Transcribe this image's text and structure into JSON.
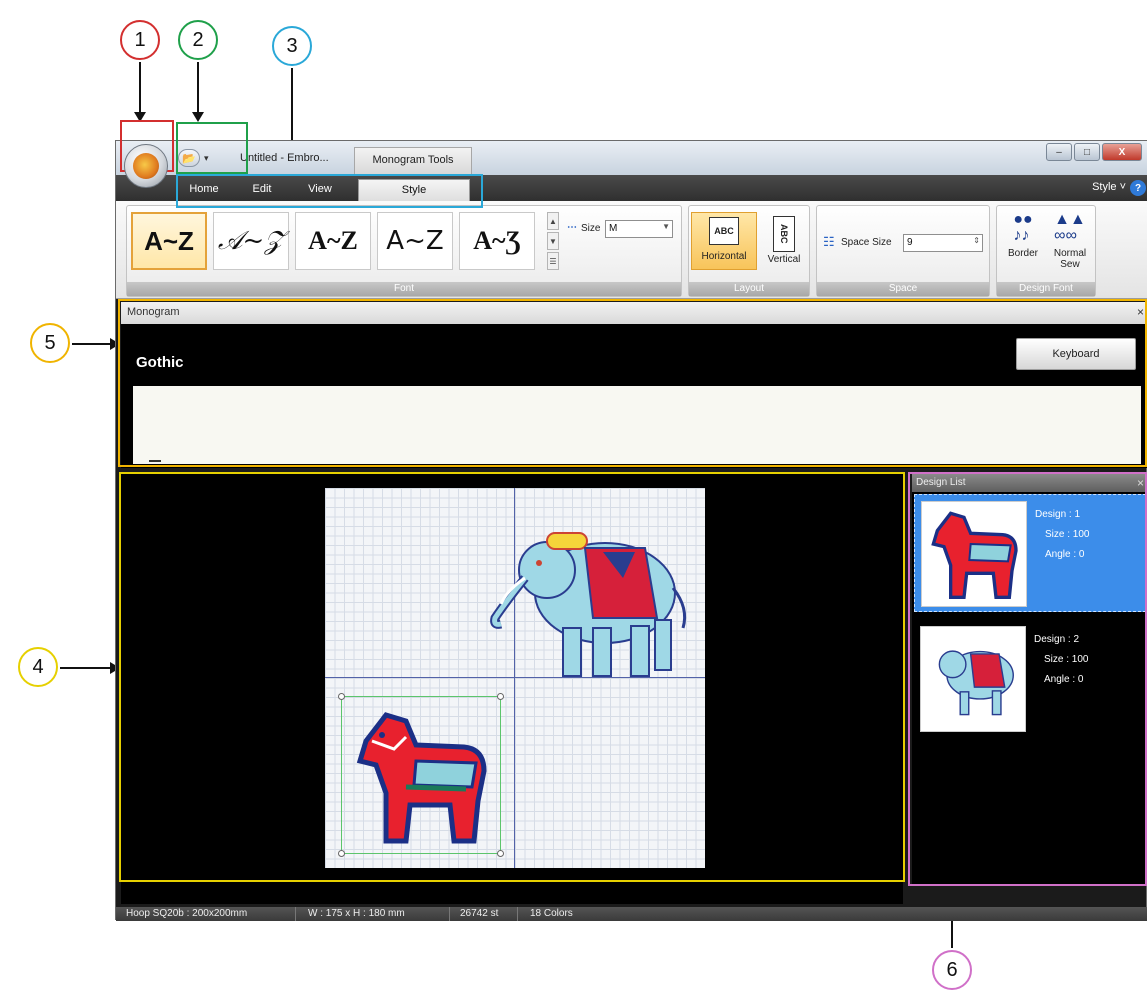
{
  "callouts": [
    "1",
    "2",
    "3",
    "4",
    "5",
    "6"
  ],
  "title_bar": {
    "document_title": "Untitled - Embro...",
    "context_tab": "Monogram Tools",
    "minimize": "–",
    "maximize": "□",
    "close": "X"
  },
  "tabs": {
    "home": "Home",
    "edit": "Edit",
    "view": "View",
    "style": "Style",
    "style_menu": "Style ˅",
    "help": "?"
  },
  "ribbon": {
    "font_group_label": "Font",
    "font_samples": [
      "A~Z",
      "𝒜~𝒵",
      "A~Z",
      "A~Z",
      "A~Ʒ"
    ],
    "size_label": "Size",
    "size_value": "M",
    "layout_group_label": "Layout",
    "horizontal_label": "Horizontal",
    "vertical_label": "Vertical",
    "abc": "ABC",
    "space_group_label": "Space",
    "space_size_label": "Space Size",
    "space_size_value": "9",
    "design_font_group_label": "Design Font",
    "border_label": "Border",
    "normal_sew_label": "Normal Sew"
  },
  "monogram": {
    "panel_title": "Monogram",
    "close": "×",
    "font_name": "Gothic",
    "keyboard_button": "Keyboard"
  },
  "design_list": {
    "title": "Design List",
    "close": "×",
    "items": [
      {
        "design": "Design : 1",
        "size": "Size : 100",
        "angle": "Angle : 0",
        "selected": true
      },
      {
        "design": "Design : 2",
        "size": "Size : 100",
        "angle": "Angle : 0",
        "selected": false
      }
    ]
  },
  "status_bar": {
    "hoop": "Hoop SQ20b : 200x200mm",
    "dimensions": "W : 175 x H : 180 mm",
    "stitches": "26742 st",
    "colors": "18 Colors"
  },
  "colors": {
    "callout_1": "#d32f2f",
    "callout_2": "#1fa04a",
    "callout_3": "#2aa8d8",
    "callout_4": "#e6d000",
    "callout_5": "#f0b400",
    "callout_6": "#d070c8",
    "selection_accent": "#3c8dea"
  }
}
